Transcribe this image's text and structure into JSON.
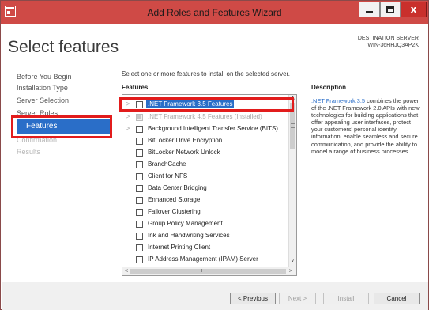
{
  "window": {
    "title": "Add Roles and Features Wizard",
    "controls": {
      "minimize": "minimize-icon",
      "maximize": "maximize-icon",
      "close": "x"
    }
  },
  "header": {
    "title": "Select features",
    "destination_label": "DESTINATION SERVER",
    "destination_server": "WIN-36HHJQ3AP2K"
  },
  "nav": {
    "items": [
      {
        "label": "Before You Begin",
        "state": "normal"
      },
      {
        "label": "Installation Type",
        "state": "normal"
      },
      {
        "label": "Server Selection",
        "state": "normal"
      },
      {
        "label": "Server Roles",
        "state": "normal"
      },
      {
        "label": "Features",
        "state": "selected"
      },
      {
        "label": "Confirmation",
        "state": "disabled"
      },
      {
        "label": "Results",
        "state": "disabled"
      }
    ]
  },
  "main": {
    "intro": "Select one or more features to install on the selected server.",
    "features_header": "Features",
    "description_header": "Description",
    "features": [
      {
        "label": ".NET Framework 3.5 Features",
        "expandable": true,
        "checked": false,
        "selected": true,
        "disabled": false
      },
      {
        "label": ".NET Framework 4.5 Features (Installed)",
        "expandable": true,
        "checked": true,
        "selected": false,
        "disabled": true
      },
      {
        "label": "Background Intelligent Transfer Service (BITS)",
        "expandable": true,
        "checked": false,
        "selected": false,
        "disabled": false
      },
      {
        "label": "BitLocker Drive Encryption",
        "expandable": false,
        "checked": false,
        "selected": false,
        "disabled": false
      },
      {
        "label": "BitLocker Network Unlock",
        "expandable": false,
        "checked": false,
        "selected": false,
        "disabled": false
      },
      {
        "label": "BranchCache",
        "expandable": false,
        "checked": false,
        "selected": false,
        "disabled": false
      },
      {
        "label": "Client for NFS",
        "expandable": false,
        "checked": false,
        "selected": false,
        "disabled": false
      },
      {
        "label": "Data Center Bridging",
        "expandable": false,
        "checked": false,
        "selected": false,
        "disabled": false
      },
      {
        "label": "Enhanced Storage",
        "expandable": false,
        "checked": false,
        "selected": false,
        "disabled": false
      },
      {
        "label": "Failover Clustering",
        "expandable": false,
        "checked": false,
        "selected": false,
        "disabled": false
      },
      {
        "label": "Group Policy Management",
        "expandable": false,
        "checked": false,
        "selected": false,
        "disabled": false
      },
      {
        "label": "Ink and Handwriting Services",
        "expandable": false,
        "checked": false,
        "selected": false,
        "disabled": false
      },
      {
        "label": "Internet Printing Client",
        "expandable": false,
        "checked": false,
        "selected": false,
        "disabled": false
      },
      {
        "label": "IP Address Management (IPAM) Server",
        "expandable": false,
        "checked": false,
        "selected": false,
        "disabled": false
      }
    ],
    "description": {
      "link_text": ".NET Framework 3.5",
      "text": " combines the power of the .NET Framework 2.0 APIs with new technologies for building applications that offer appealing user interfaces, protect your customers' personal identity information, enable seamless and secure communication, and provide the ability to model a range of business processes."
    }
  },
  "footer": {
    "previous": "< Previous",
    "next": "Next >",
    "install": "Install",
    "cancel": "Cancel"
  },
  "colors": {
    "titlebar": "#cf4a46",
    "selection": "#2a6ec8",
    "highlight_box": "#e21c1c"
  }
}
